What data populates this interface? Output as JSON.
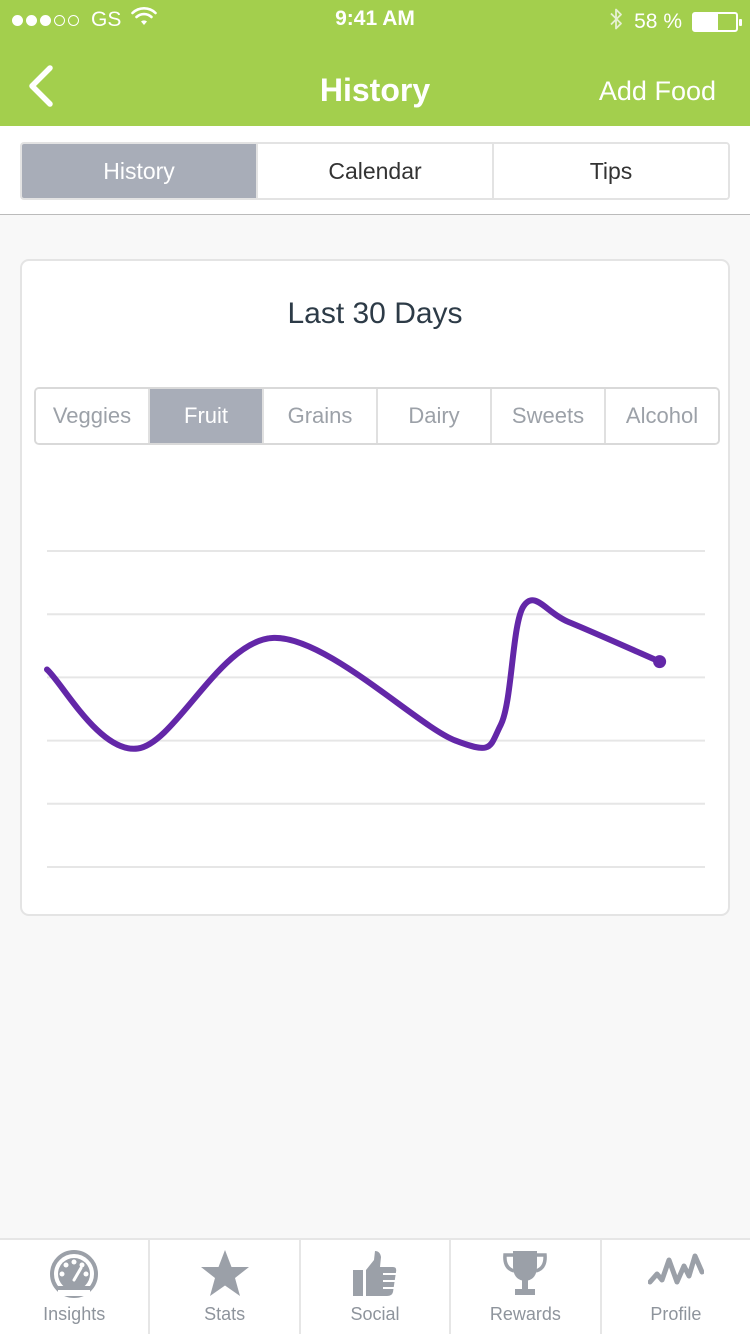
{
  "status_bar": {
    "signal_dots": [
      true,
      true,
      true,
      false,
      false
    ],
    "carrier": "GS",
    "time": "9:41 AM",
    "battery_text": "58 %",
    "battery_level": 0.58
  },
  "nav": {
    "title": "History",
    "action": "Add Food",
    "back_icon": "chevron-left-icon"
  },
  "top_tabs": [
    {
      "label": "History",
      "active": true
    },
    {
      "label": "Calendar",
      "active": false
    },
    {
      "label": "Tips",
      "active": false
    }
  ],
  "card": {
    "title": "Last 30 Days",
    "categories": [
      {
        "label": "Veggies",
        "active": false
      },
      {
        "label": "Fruit",
        "active": true
      },
      {
        "label": "Grains",
        "active": false
      },
      {
        "label": "Dairy",
        "active": false
      },
      {
        "label": "Sweets",
        "active": false
      },
      {
        "label": "Alcohol",
        "active": false
      }
    ]
  },
  "chart_data": {
    "type": "line",
    "x": [
      1,
      5,
      11,
      19,
      21,
      22,
      24,
      28
    ],
    "series": [
      {
        "values": [
          2.5,
          1.5,
          2.9,
          1.6,
          1.8,
          3.3,
          3.1,
          2.6
        ],
        "color": "#6327a8"
      }
    ],
    "ylim": [
      0,
      4
    ],
    "xlim": [
      1,
      30
    ],
    "gridlines": 6,
    "grid": true
  },
  "tabbar": [
    {
      "label": "Insights",
      "icon": "speedometer-icon"
    },
    {
      "label": "Stats",
      "icon": "star-icon"
    },
    {
      "label": "Social",
      "icon": "thumbs-up-icon"
    },
    {
      "label": "Rewards",
      "icon": "trophy-icon"
    },
    {
      "label": "Profile",
      "icon": "activity-icon"
    }
  ],
  "colors": {
    "header": "#a3cf4d",
    "segment_active": "#a8adb8",
    "line": "#6327a8",
    "tab_icon": "#9ba0a8"
  }
}
